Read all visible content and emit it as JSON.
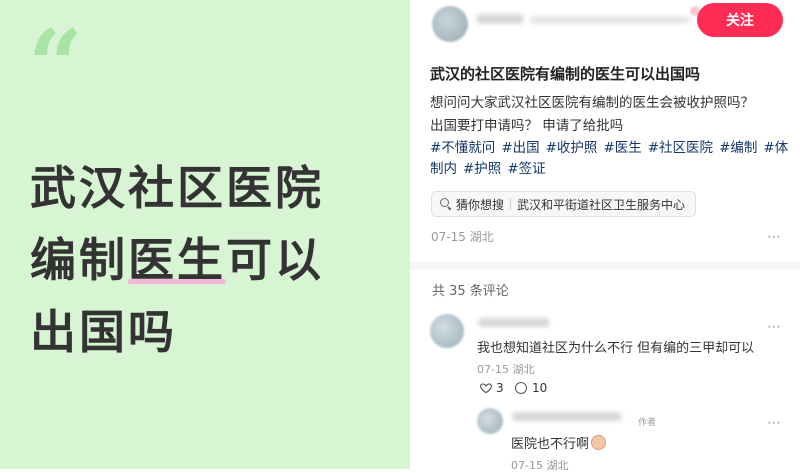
{
  "cover": {
    "quote_mark": "“",
    "headline_line1": "武汉社区医院",
    "headline_line2_a": "编制",
    "headline_line2_b": "医生",
    "headline_line2_c": "可以",
    "headline_line3": "出国吗",
    "background_color": "#d7f5d3",
    "highlight_color": "#f2b8d8"
  },
  "post": {
    "follow_label": "关注",
    "title": "武汉的社区医院有编制的医生可以出国吗",
    "body_line1": "想问问大家武汉社区医院有编制的医生会被收护照吗？",
    "body_line2": "出国要打申请吗？ 申请了给批吗",
    "tags": [
      "#不懂就问",
      "#出国",
      "#收护照",
      "#医生",
      "#社区医院",
      "#编制",
      "#体制内",
      "#护照",
      "#签证"
    ],
    "search_prefix": "猜你想搜",
    "search_query": "武汉和平街道社区卫生服务中心",
    "meta": "07-15 湖北",
    "more_icon": "⋯"
  },
  "comments": {
    "count_label": "共 35 条评论",
    "items": [
      {
        "text": "我也想知道社区为什么不行 但有编的三甲却可以",
        "meta": "07-15 湖北",
        "likes": "3",
        "replies": "10"
      },
      {
        "author_tag": "作者",
        "text": "医院也不行啊",
        "meta": "07-15 湖北"
      }
    ]
  },
  "colors": {
    "accent": "#fe2c55",
    "tag": "#13386c"
  },
  "icons": {
    "search": "search-icon",
    "more": "more-dots-icon",
    "like": "heart-icon",
    "reply": "comment-bubble-icon"
  }
}
